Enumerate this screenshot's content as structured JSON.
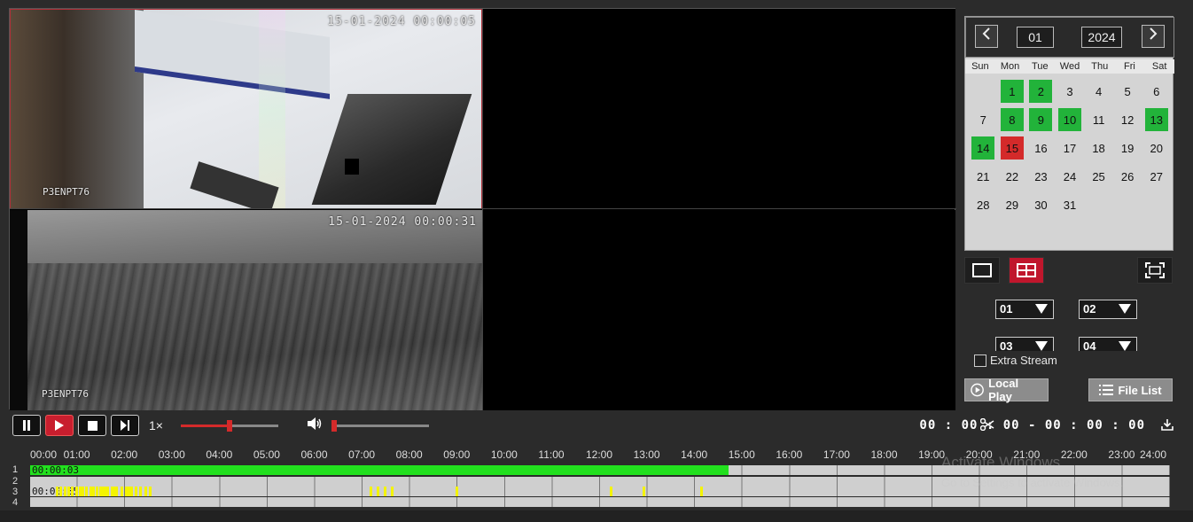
{
  "cameras": [
    {
      "timestamp": "15-01-2024 00:00:05",
      "name": "P3ENPT76"
    },
    {
      "timestamp": "15-01-2024 00:00:31",
      "name": "P3ENPT76"
    }
  ],
  "calendar": {
    "month": "01",
    "year": "2024",
    "weekdays": [
      "Sun",
      "Mon",
      "Tue",
      "Wed",
      "Thu",
      "Fri",
      "Sat"
    ],
    "days": [
      "",
      "1",
      "2",
      "3",
      "4",
      "5",
      "6",
      "7",
      "8",
      "9",
      "10",
      "11",
      "12",
      "13",
      "14",
      "15",
      "16",
      "17",
      "18",
      "19",
      "20",
      "21",
      "22",
      "23",
      "24",
      "25",
      "26",
      "27",
      "28",
      "29",
      "30",
      "31"
    ],
    "recorded_days": [
      "1",
      "2",
      "8",
      "9",
      "10",
      "13",
      "14"
    ],
    "selected_day": "15",
    "record_color": "#22b33a",
    "selected_color": "#d42a2a"
  },
  "channel_selects": [
    "01",
    "02",
    "03",
    "04"
  ],
  "extra_stream_label": "Extra Stream",
  "local_play_label": "Local Play",
  "file_list_label": "File List",
  "speed_label": "1×",
  "clip_time": "00 : 00 : 00 - 00 : 00 : 00",
  "timeline": {
    "hours": [
      "00:00",
      "01:00",
      "02:00",
      "03:00",
      "04:00",
      "05:00",
      "06:00",
      "07:00",
      "08:00",
      "09:00",
      "10:00",
      "11:00",
      "12:00",
      "13:00",
      "14:00",
      "15:00",
      "16:00",
      "17:00",
      "18:00",
      "19:00",
      "20:00",
      "21:00",
      "22:00",
      "23:00",
      "24:00"
    ],
    "channels": [
      "1",
      "2",
      "3",
      "4"
    ],
    "ch1_label": "00:00:03",
    "ch3_label": "00:00:35",
    "ch1_record_end_hour": 14.7,
    "accent_green": "#22e01e",
    "accent_yellow": "#f4f400"
  },
  "watermark": {
    "line1": "Activate Windows",
    "line2": "Go to Settings to activate Windows."
  }
}
